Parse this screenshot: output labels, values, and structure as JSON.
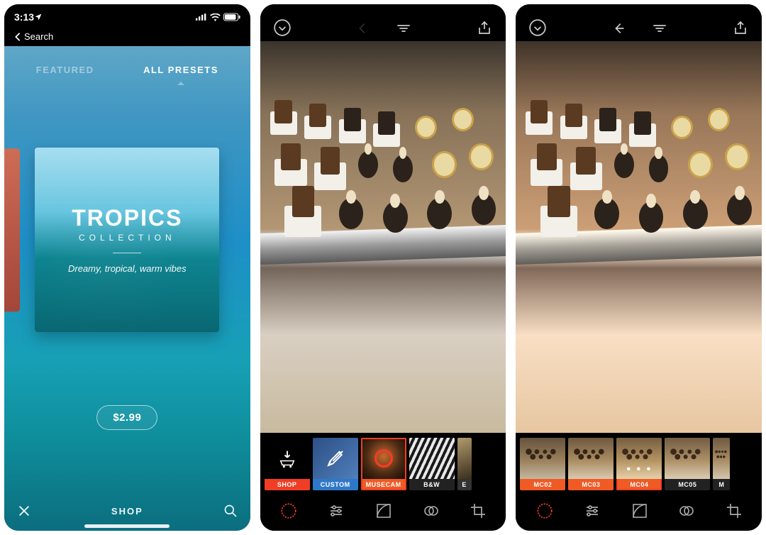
{
  "screen1": {
    "status_time": "3:13",
    "back_label": "Search",
    "tabs": {
      "featured": "FEATURED",
      "all": "ALL PRESETS",
      "active": "all"
    },
    "card": {
      "title": "TROPICS",
      "subtitle": "COLLECTION",
      "tagline": "Dreamy, tropical, warm vibes"
    },
    "price": "$2.99",
    "bottom_label": "SHOP"
  },
  "screen2": {
    "top": {
      "back_enabled": false
    },
    "filters": [
      {
        "id": "shop",
        "label": "SHOP",
        "bg": "#000000",
        "label_bg": "#ef3e25",
        "icon": "cart"
      },
      {
        "id": "custom",
        "label": "CUSTOM",
        "bg": "#3d6fb5",
        "label_bg": "#2f78c9",
        "icon": "brush"
      },
      {
        "id": "musecam",
        "label": "MUSECAM",
        "bg": "#4a2a14",
        "label_bg": "#ef5a25",
        "icon": "ring",
        "selected": true
      },
      {
        "id": "bw",
        "label": "B&W",
        "bg": "#4a4a4a",
        "label_bg": "#222222"
      },
      {
        "id": "extra",
        "label": "E",
        "bg": "#6a5a3e",
        "label_bg": "#333333"
      }
    ],
    "tools_active": "presets"
  },
  "screen3": {
    "top": {
      "back_enabled": true
    },
    "filters": [
      {
        "id": "mc02",
        "label": "MC02",
        "label_bg": "#ef5a25"
      },
      {
        "id": "mc03",
        "label": "MC03",
        "label_bg": "#ef5a25"
      },
      {
        "id": "mc04",
        "label": "MC04",
        "label_bg": "#ef5a25",
        "selected": true,
        "dots": "• • •"
      },
      {
        "id": "mc05",
        "label": "MC05",
        "label_bg": "#222222"
      },
      {
        "id": "mc06",
        "label": "M",
        "label_bg": "#222222"
      }
    ],
    "tools_active": "presets"
  },
  "tool_icons": [
    "presets",
    "sliders",
    "curves",
    "overlay",
    "crop"
  ],
  "colors": {
    "accent": "#ef3e25"
  }
}
